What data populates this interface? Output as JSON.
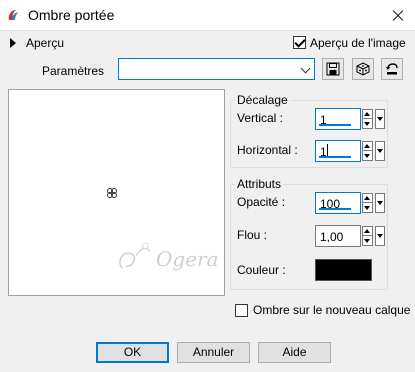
{
  "window": {
    "title": "Ombre portée"
  },
  "apercu": {
    "label": "Aperçu",
    "preview_checkbox_label": "Aperçu de l'image",
    "preview_checked": true
  },
  "params": {
    "label": "Paramètres",
    "value": ""
  },
  "icons": {
    "title": "paint-palette-icon",
    "save": "save-disk-icon",
    "random": "dice-icon",
    "reset": "reset-arrow-icon"
  },
  "decalage": {
    "title": "Décalage",
    "vertical_label": "Vertical :",
    "vertical_value": "1",
    "horizontal_label": "Horizontal :",
    "horizontal_value": "1"
  },
  "attributs": {
    "title": "Attributs",
    "opacite_label": "Opacité :",
    "opacite_value": "100",
    "flou_label": "Flou :",
    "flou_value": "1,00",
    "couleur_label": "Couleur :",
    "couleur_value": "#000000"
  },
  "ombre_nouveau_calque": {
    "label": "Ombre sur le nouveau calque",
    "checked": false
  },
  "watermark_text": "Ogera",
  "buttons": {
    "ok": "OK",
    "annuler": "Annuler",
    "aide": "Aide"
  }
}
